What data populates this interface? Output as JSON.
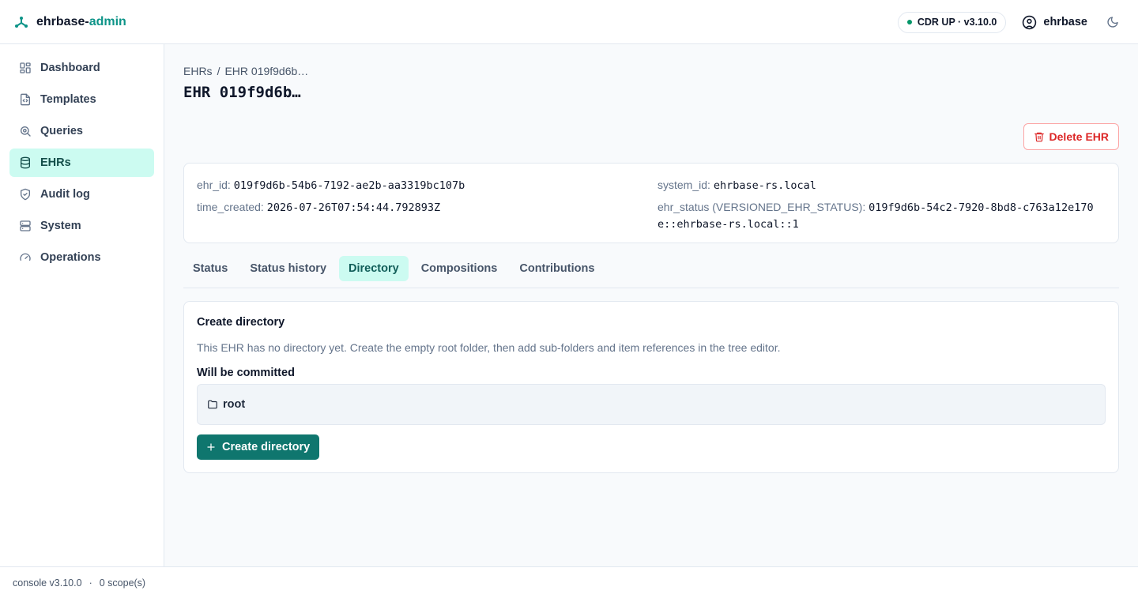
{
  "app": {
    "brand_part1": "ehrbase-",
    "brand_part2": "admin"
  },
  "header": {
    "status_badge": "CDR UP · v3.10.0",
    "username": "ehrbase",
    "status_color": "#059669",
    "accent_color": "#0d9488"
  },
  "sidebar": {
    "items": [
      {
        "label": "Dashboard",
        "icon": "dashboard-icon"
      },
      {
        "label": "Templates",
        "icon": "templates-icon"
      },
      {
        "label": "Queries",
        "icon": "queries-icon"
      },
      {
        "label": "EHRs",
        "icon": "database-icon",
        "active": true
      },
      {
        "label": "Audit log",
        "icon": "shield-check-icon"
      },
      {
        "label": "System",
        "icon": "server-icon"
      },
      {
        "label": "Operations",
        "icon": "gauge-icon"
      }
    ]
  },
  "breadcrumb": {
    "parent": "EHRs",
    "separator": "/",
    "current": "EHR 019f9d6b…"
  },
  "page": {
    "title": "EHR 019f9d6b…",
    "delete_label": "Delete EHR"
  },
  "ehr_info": {
    "ehr_id_label": "ehr_id:",
    "ehr_id": "019f9d6b-54b6-7192-ae2b-aa3319bc107b",
    "time_created_label": "time_created:",
    "time_created": "2026-07-26T07:54:44.792893Z",
    "system_id_label": "system_id:",
    "system_id": "ehrbase-rs.local",
    "ehr_status_label": "ehr_status (VERSIONED_EHR_STATUS):",
    "ehr_status": "019f9d6b-54c2-7920-8bd8-c763a12e170e::ehrbase-rs.local::1"
  },
  "tabs": [
    {
      "label": "Status"
    },
    {
      "label": "Status history"
    },
    {
      "label": "Directory",
      "active": true
    },
    {
      "label": "Compositions"
    },
    {
      "label": "Contributions"
    }
  ],
  "directory": {
    "title": "Create directory",
    "description": "This EHR has no directory yet. Create the empty root folder, then add sub-folders and item references in the tree editor.",
    "commit_label": "Will be committed",
    "root_folder": "root",
    "create_button": "Create directory"
  },
  "footer": {
    "console_version": "console v3.10.0",
    "separator": "·",
    "scopes": "0 scope(s)"
  }
}
